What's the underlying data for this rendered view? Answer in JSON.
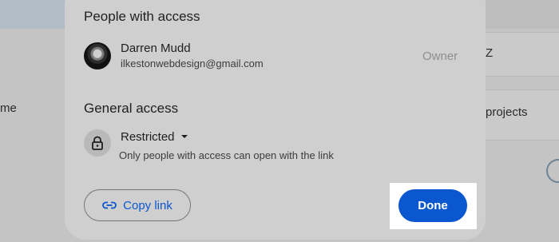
{
  "background": {
    "left_text": "me",
    "right_row_1_text": "Z",
    "right_row_2_text": "projects"
  },
  "dialog": {
    "people_section_title": "People with access",
    "person": {
      "name": "Darren Mudd",
      "email": "ilkestonwebdesign@gmail.com",
      "role": "Owner"
    },
    "general_access_title": "General access",
    "access_level": "Restricted",
    "access_description": "Only people with access can open with the link",
    "copy_link_label": "Copy link",
    "done_label": "Done"
  },
  "colors": {
    "accent": "#0b57d0",
    "dialog_bg": "#cfcfcf",
    "scrim_bg": "#c4c4c4"
  },
  "icons": {
    "copy_link": "link-icon",
    "access": "lock-icon",
    "dropdown": "caret-down-icon",
    "avatar": "profile-photo"
  }
}
